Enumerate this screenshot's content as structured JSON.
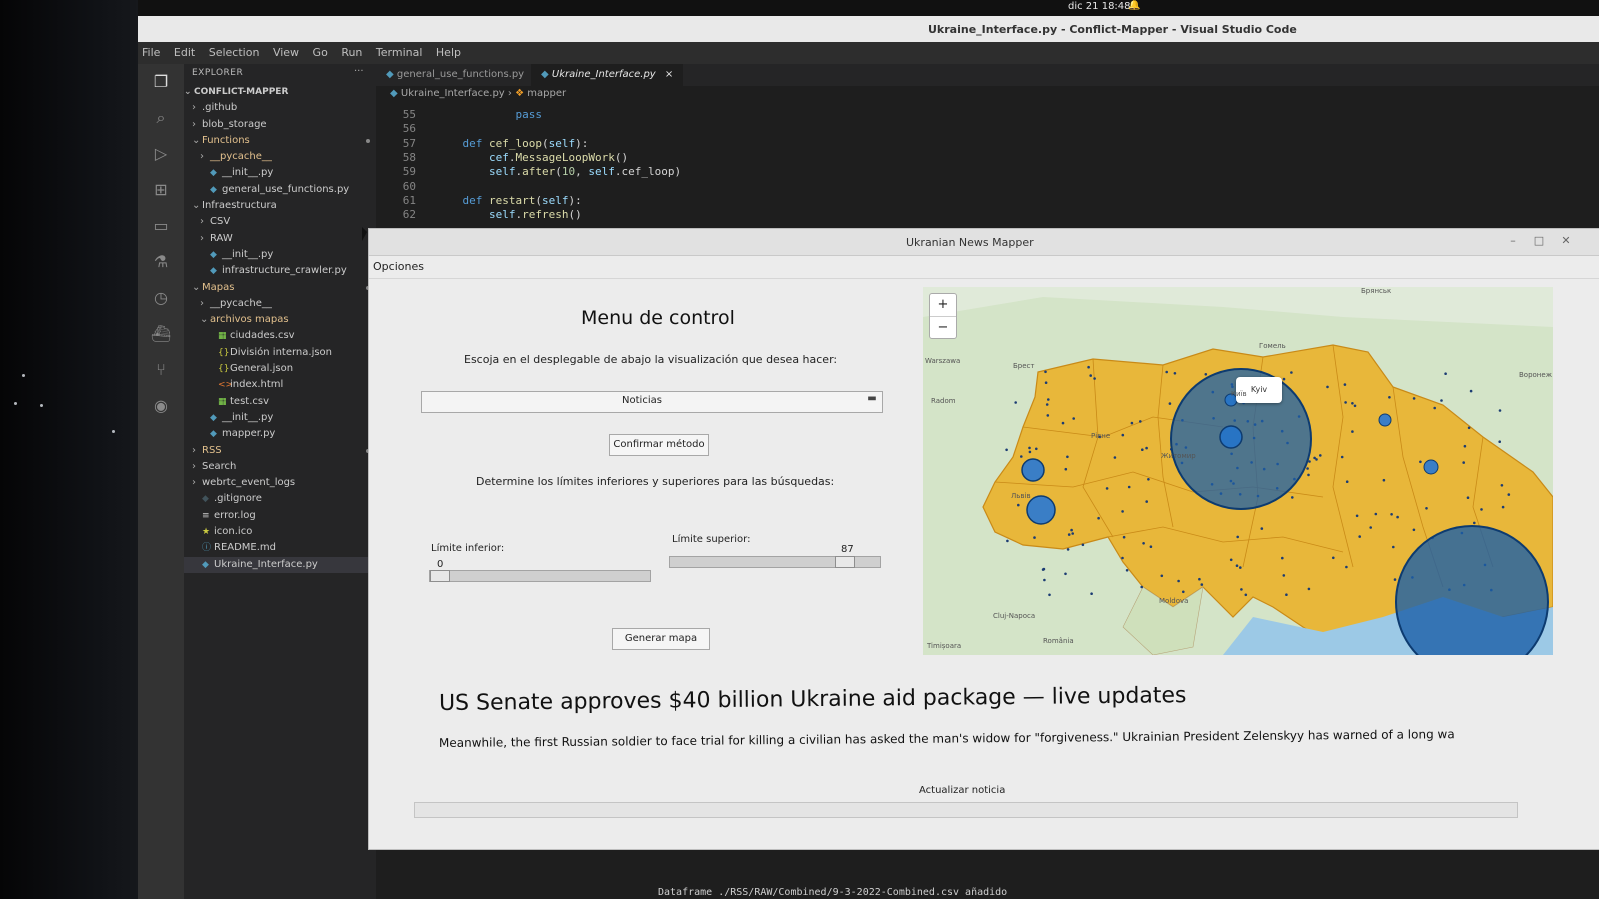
{
  "system": {
    "clock": "dic 21  18:48"
  },
  "vscode": {
    "title": "Ukraine_Interface.py - Conflict-Mapper - Visual Studio Code",
    "menu": [
      "File",
      "Edit",
      "Selection",
      "View",
      "Go",
      "Run",
      "Terminal",
      "Help"
    ],
    "explorer_label": "EXPLORER",
    "project": "CONFLICT-MAPPER",
    "tree": [
      {
        "name": ".github",
        "kind": "folder",
        "depth": 1,
        "open": false
      },
      {
        "name": "blob_storage",
        "kind": "folder",
        "depth": 1,
        "open": false
      },
      {
        "name": "Functions",
        "kind": "folder",
        "depth": 1,
        "open": true,
        "color": "#e2c08d"
      },
      {
        "name": "__pycache__",
        "kind": "folder",
        "depth": 2,
        "open": false,
        "color": "#e2c08d"
      },
      {
        "name": "__init__.py",
        "kind": "py",
        "depth": 2
      },
      {
        "name": "general_use_functions.py",
        "kind": "py",
        "depth": 2
      },
      {
        "name": "Infraestructura",
        "kind": "folder",
        "depth": 1,
        "open": true
      },
      {
        "name": "CSV",
        "kind": "folder",
        "depth": 2,
        "open": false
      },
      {
        "name": "RAW",
        "kind": "folder",
        "depth": 2,
        "open": false
      },
      {
        "name": "__init__.py",
        "kind": "py",
        "depth": 2
      },
      {
        "name": "infrastructure_crawler.py",
        "kind": "py",
        "depth": 2
      },
      {
        "name": "Mapas",
        "kind": "folder",
        "depth": 1,
        "open": true,
        "color": "#e2c08d"
      },
      {
        "name": "__pycache__",
        "kind": "folder",
        "depth": 2,
        "open": false
      },
      {
        "name": "archivos mapas",
        "kind": "folder",
        "depth": 2,
        "open": true,
        "color": "#e2c08d"
      },
      {
        "name": "ciudades.csv",
        "kind": "csv",
        "depth": 3
      },
      {
        "name": "División interna.json",
        "kind": "json",
        "depth": 3
      },
      {
        "name": "General.json",
        "kind": "json",
        "depth": 3
      },
      {
        "name": "index.html",
        "kind": "html",
        "depth": 3
      },
      {
        "name": "test.csv",
        "kind": "csv",
        "depth": 3
      },
      {
        "name": "__init__.py",
        "kind": "py",
        "depth": 2
      },
      {
        "name": "mapper.py",
        "kind": "py",
        "depth": 2
      },
      {
        "name": "RSS",
        "kind": "folder",
        "depth": 1,
        "open": false,
        "color": "#e2c08d"
      },
      {
        "name": "Search",
        "kind": "folder",
        "depth": 1,
        "open": false
      },
      {
        "name": "webrtc_event_logs",
        "kind": "folder",
        "depth": 1,
        "open": false
      },
      {
        "name": ".gitignore",
        "kind": "git",
        "depth": 1
      },
      {
        "name": "error.log",
        "kind": "log",
        "depth": 1
      },
      {
        "name": "icon.ico",
        "kind": "ico",
        "depth": 1
      },
      {
        "name": "README.md",
        "kind": "md",
        "depth": 1
      },
      {
        "name": "Ukraine_Interface.py",
        "kind": "py",
        "depth": 1,
        "selected": true
      }
    ],
    "tabs": [
      "general_use_functions.py",
      "Ukraine_Interface.py"
    ],
    "breadcrumb": [
      "Ukraine_Interface.py",
      "mapper"
    ],
    "code": [
      {
        "ln": "55",
        "text": "            pass"
      },
      {
        "ln": "56",
        "text": ""
      },
      {
        "ln": "57",
        "text": "    def cef_loop(self):"
      },
      {
        "ln": "58",
        "text": "        cef.MessageLoopWork()"
      },
      {
        "ln": "59",
        "text": "        self.after(10, self.cef_loop)"
      },
      {
        "ln": "60",
        "text": ""
      },
      {
        "ln": "61",
        "text": "    def restart(self):"
      },
      {
        "ln": "62",
        "text": "        self.refresh()"
      }
    ],
    "terminal_line": "Dataframe ./RSS/RAW/Combined/9-3-2022-Combined.csv añadido"
  },
  "app": {
    "title": "Ukranian News Mapper",
    "menu_opciones": "Opciones",
    "control_title": "Menu de control",
    "control_subtitle": "Escoja en el desplegable de abajo la visualización que desea hacer:",
    "dropdown_value": "Noticias",
    "confirm_button": "Confirmar método",
    "limits_text": "Determine los límites inferiores y superiores para las búsquedas:",
    "lower_label": "Límite inferior:",
    "lower_value": "0",
    "lower_fraction": 0.0,
    "upper_label": "Límite superior:",
    "upper_value": "87",
    "upper_fraction": 0.87,
    "generate_button": "Generar mapa",
    "map_popup": "Kyiv",
    "headline": "US Senate approves $40 billion Ukraine aid package — live updates",
    "description": "Meanwhile, the first Russian soldier to face trial for killing a civilian has asked the man's widow for \"forgiveness.\" Ukrainian President Zelenskyy has warned of a long wa",
    "update_label": "Actualizar noticia",
    "zoom_in": "+",
    "zoom_out": "−",
    "map_labels": [
      "Warszawa",
      "Брест",
      "Київ",
      "Гомель",
      "Брянськ",
      "Воронеж",
      "Moldova",
      "Cluj-Napoca",
      "România",
      "Timișoara",
      "Radom",
      "Рівне",
      "Житомир",
      "Львів"
    ],
    "colors": {
      "ukraine_fill": "#e8b73a",
      "region_border": "#c98a17",
      "circles": "#1c5fa8",
      "map_base": "#cfe1c2"
    }
  }
}
